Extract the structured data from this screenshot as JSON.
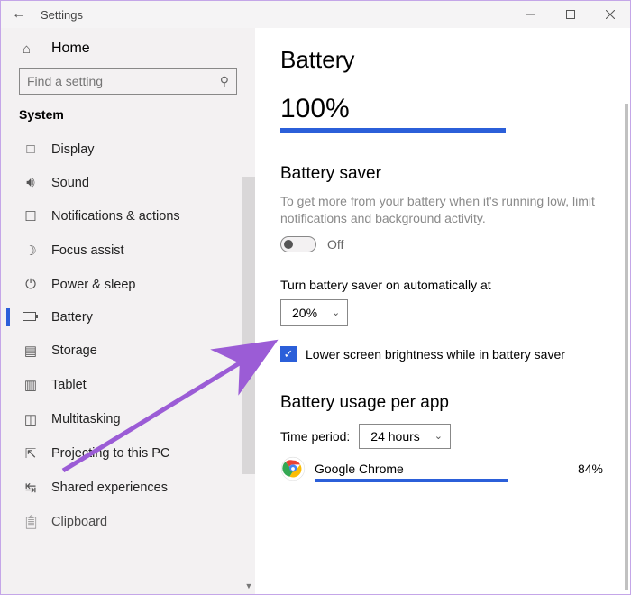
{
  "window": {
    "title": "Settings"
  },
  "sidebar": {
    "home": "Home",
    "search_placeholder": "Find a setting",
    "section": "System",
    "items": [
      {
        "label": "Display"
      },
      {
        "label": "Sound"
      },
      {
        "label": "Notifications & actions"
      },
      {
        "label": "Focus assist"
      },
      {
        "label": "Power & sleep"
      },
      {
        "label": "Battery",
        "selected": true
      },
      {
        "label": "Storage"
      },
      {
        "label": "Tablet"
      },
      {
        "label": "Multitasking"
      },
      {
        "label": "Projecting to this PC"
      },
      {
        "label": "Shared experiences"
      },
      {
        "label": "Clipboard"
      }
    ]
  },
  "main": {
    "page_title": "Battery",
    "percent": "100%",
    "saver_heading": "Battery saver",
    "saver_desc": "To get more from your battery when it's running low, limit notifications and background activity.",
    "saver_toggle_state": "Off",
    "auto_label": "Turn battery saver on automatically at",
    "auto_value": "20%",
    "brightness_checkbox": "Lower screen brightness while in battery saver",
    "usage_heading": "Battery usage per app",
    "time_period_label": "Time period:",
    "time_period_value": "24 hours",
    "apps": [
      {
        "name": "Google Chrome",
        "percent": "84%"
      }
    ]
  }
}
